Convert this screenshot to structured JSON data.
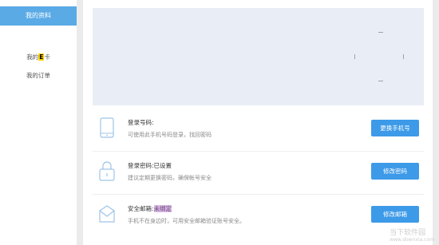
{
  "sidebar": {
    "active_label": "我的资料",
    "ecard_prefix": "我的",
    "ecard_badge": "E",
    "ecard_suffix": "卡",
    "orders_label": "我的订单"
  },
  "security": {
    "phone": {
      "title": "登录号码:",
      "desc": "可使用此手机号码登录，找回密码",
      "button": "更换手机号"
    },
    "password": {
      "title": "登录密码:已设置",
      "desc": "建议定期更换密码，确保帐号安全",
      "button": "修改密码"
    },
    "email": {
      "title_prefix": "安全邮箱:",
      "title_status": "未绑定",
      "desc": "手机不在身边时，可用安全邮箱验证账号安全。",
      "button": "修改邮箱"
    }
  },
  "watermark": {
    "text": "当下软件园",
    "url": "www.downxia.com"
  },
  "colors": {
    "accent": "#3d9ae8",
    "sidebar_active": "#5aaae6",
    "banner_bg": "#e9eef6"
  }
}
